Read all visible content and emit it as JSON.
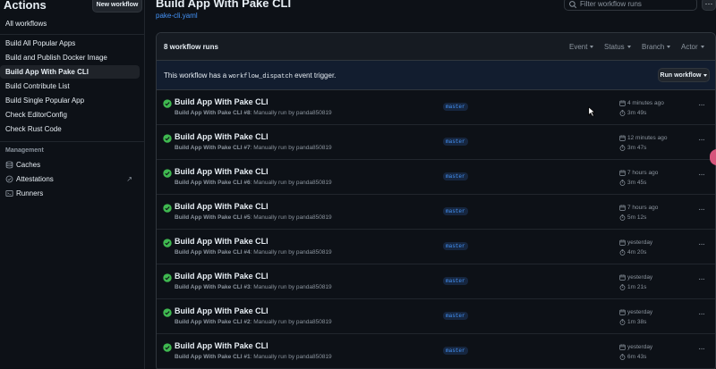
{
  "sidebar": {
    "title": "Actions",
    "new_workflow": "New workflow",
    "all_workflows": "All workflows",
    "workflows": [
      {
        "label": "Build All Popular Apps",
        "active": false
      },
      {
        "label": "Build and Publish Docker Image",
        "active": false
      },
      {
        "label": "Build App With Pake CLI",
        "active": true
      },
      {
        "label": "Build Contribute List",
        "active": false
      },
      {
        "label": "Build Single Popular App",
        "active": false
      },
      {
        "label": "Check EditorConfig",
        "active": false
      },
      {
        "label": "Check Rust Code",
        "active": false
      }
    ],
    "management_heading": "Management",
    "management": [
      {
        "label": "Caches",
        "icon": "cache-icon"
      },
      {
        "label": "Attestations",
        "icon": "attestation-icon",
        "external_icon": "↗"
      },
      {
        "label": "Runners",
        "icon": "runners-icon"
      }
    ]
  },
  "header": {
    "title": "Build App With Pake CLI",
    "file": "pake-cli.yaml",
    "search_placeholder": "Filter workflow runs",
    "more": "···"
  },
  "runs_header": {
    "count": "8 workflow runs",
    "filters": [
      "Event",
      "Status",
      "Branch",
      "Actor"
    ]
  },
  "dispatch": {
    "prefix": "This workflow has a",
    "code": "workflow_dispatch",
    "suffix": "event trigger.",
    "button": "Run workflow"
  },
  "runs": [
    {
      "title": "Build App With Pake CLI",
      "workflow": "Build App With Pake CLI",
      "run": "#8",
      "by": "Manually run by panda850819",
      "branch": "master",
      "when": "4 minutes ago",
      "duration": "3m 49s"
    },
    {
      "title": "Build App With Pake CLI",
      "workflow": "Build App With Pake CLI",
      "run": "#7",
      "by": "Manually run by panda850819",
      "branch": "master",
      "when": "12 minutes ago",
      "duration": "3m 47s"
    },
    {
      "title": "Build App With Pake CLI",
      "workflow": "Build App With Pake CLI",
      "run": "#6",
      "by": "Manually run by panda850819",
      "branch": "master",
      "when": "7 hours ago",
      "duration": "3m 45s"
    },
    {
      "title": "Build App With Pake CLI",
      "workflow": "Build App With Pake CLI",
      "run": "#5",
      "by": "Manually run by panda850819",
      "branch": "master",
      "when": "7 hours ago",
      "duration": "5m 12s"
    },
    {
      "title": "Build App With Pake CLI",
      "workflow": "Build App With Pake CLI",
      "run": "#4",
      "by": "Manually run by panda850819",
      "branch": "master",
      "when": "yesterday",
      "duration": "4m 20s"
    },
    {
      "title": "Build App With Pake CLI",
      "workflow": "Build App With Pake CLI",
      "run": "#3",
      "by": "Manually run by panda850819",
      "branch": "master",
      "when": "yesterday",
      "duration": "1m 21s"
    },
    {
      "title": "Build App With Pake CLI",
      "workflow": "Build App With Pake CLI",
      "run": "#2",
      "by": "Manually run by panda850819",
      "branch": "master",
      "when": "yesterday",
      "duration": "1m 38s"
    },
    {
      "title": "Build App With Pake CLI",
      "workflow": "Build App With Pake CLI",
      "run": "#1",
      "by": "Manually run by panda850819",
      "branch": "master",
      "when": "yesterday",
      "duration": "6m 43s"
    }
  ],
  "colors": {
    "success": "#3fb950",
    "link": "#4493f8",
    "background": "#0d1117",
    "border": "#30363d"
  }
}
